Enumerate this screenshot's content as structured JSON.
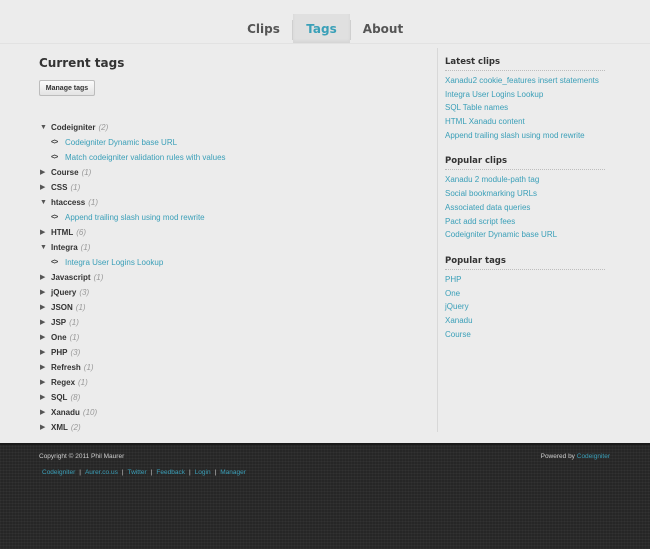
{
  "nav": {
    "tabs": [
      {
        "label": "Clips",
        "active": false
      },
      {
        "label": "Tags",
        "active": true
      },
      {
        "label": "About",
        "active": false
      }
    ]
  },
  "main": {
    "title": "Current tags",
    "manage_button": "Manage tags",
    "tags": [
      {
        "name": "Codeigniter",
        "count": "(2)",
        "expanded": true,
        "clips": [
          "Codeigniter Dynamic base URL",
          "Match codeigniter validation rules with values"
        ]
      },
      {
        "name": "Course",
        "count": "(1)",
        "expanded": false,
        "clips": []
      },
      {
        "name": "CSS",
        "count": "(1)",
        "expanded": false,
        "clips": []
      },
      {
        "name": "htaccess",
        "count": "(1)",
        "expanded": true,
        "clips": [
          "Append trailing slash using mod rewrite"
        ]
      },
      {
        "name": "HTML",
        "count": "(6)",
        "expanded": false,
        "clips": []
      },
      {
        "name": "Integra",
        "count": "(1)",
        "expanded": true,
        "clips": [
          "Integra User Logins Lookup"
        ]
      },
      {
        "name": "Javascript",
        "count": "(1)",
        "expanded": false,
        "clips": []
      },
      {
        "name": "jQuery",
        "count": "(3)",
        "expanded": false,
        "clips": []
      },
      {
        "name": "JSON",
        "count": "(1)",
        "expanded": false,
        "clips": []
      },
      {
        "name": "JSP",
        "count": "(1)",
        "expanded": false,
        "clips": []
      },
      {
        "name": "One",
        "count": "(1)",
        "expanded": false,
        "clips": []
      },
      {
        "name": "PHP",
        "count": "(3)",
        "expanded": false,
        "clips": []
      },
      {
        "name": "Refresh",
        "count": "(1)",
        "expanded": false,
        "clips": []
      },
      {
        "name": "Regex",
        "count": "(1)",
        "expanded": false,
        "clips": []
      },
      {
        "name": "SQL",
        "count": "(8)",
        "expanded": false,
        "clips": []
      },
      {
        "name": "Xanadu",
        "count": "(10)",
        "expanded": false,
        "clips": []
      },
      {
        "name": "XML",
        "count": "(2)",
        "expanded": false,
        "clips": []
      }
    ]
  },
  "sidebar": {
    "sections": [
      {
        "heading": "Latest clips",
        "links": [
          "Xanadu2 cookie_features insert statements",
          "Integra User Logins Lookup",
          "SQL Table names",
          "HTML Xanadu content",
          "Append trailing slash using mod rewrite"
        ]
      },
      {
        "heading": "Popular clips",
        "links": [
          "Xanadu 2 module-path tag",
          "Social bookmarking URLs",
          "Associated data queries",
          "Pact add script fees",
          "Codeigniter Dynamic base URL"
        ]
      },
      {
        "heading": "Popular tags",
        "links": [
          "PHP",
          "One",
          "jQuery",
          "Xanadu",
          "Course"
        ]
      }
    ]
  },
  "footer": {
    "copyright": "Copyright © 2011 Phil Maurer",
    "powered_prefix": "Powered by",
    "powered_link": "Codeigniter",
    "links": [
      "Codeigniter",
      "Aurer.co.us",
      "Twitter",
      "Feedback",
      "Login",
      "Manager"
    ]
  },
  "colors": {
    "accent": "#3a9fb8",
    "background": "#ececec",
    "footer": "#262626"
  }
}
